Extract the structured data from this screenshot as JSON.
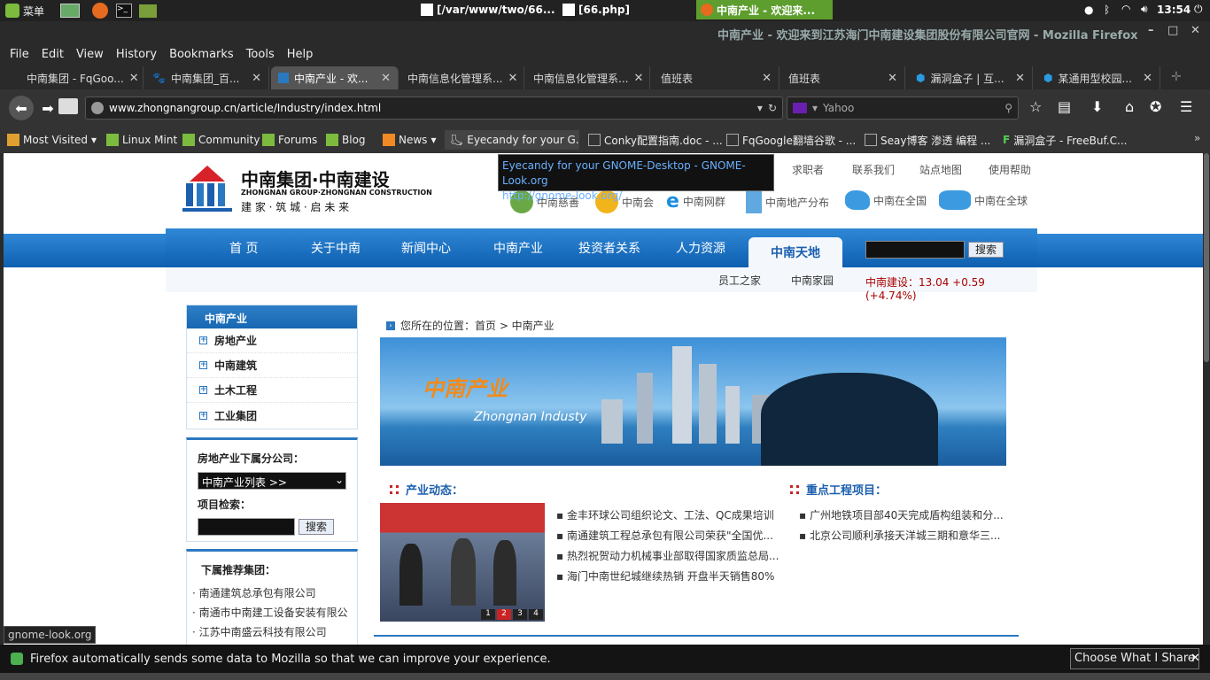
{
  "panel": {
    "menu": "菜单",
    "tasks": [
      "[/var/www/two/66...",
      "[66.php]",
      "中南产业 - 欢迎来..."
    ],
    "clock": "13:54"
  },
  "window_title": "中南产业 - 欢迎来到江苏海门中南建设集团股份有限公司官网 - Mozilla Firefox",
  "menu": [
    "File",
    "Edit",
    "View",
    "History",
    "Bookmarks",
    "Tools",
    "Help"
  ],
  "tabs": [
    "中南集团 - FqGoo...",
    "中南集团_百...",
    "中南产业 - 欢...",
    "中南信息化管理系...",
    "中南信息化管理系...",
    "值班表",
    "值班表",
    "漏洞盒子 | 互...",
    "某通用型校园..."
  ],
  "url": "www.zhongnangroup.cn/article/Industry/index.html",
  "search_engine": "Yahoo",
  "bookmarks": [
    "Most Visited",
    "Linux Mint",
    "Community",
    "Forums",
    "Blog",
    "News",
    "Eyecandy for your G...",
    "Conky配置指南.doc - ...",
    "FqGoogle翻墙谷歌 - ...",
    "Seay博客 渗透 编程 ...",
    "漏洞盒子 - FreeBuf.C..."
  ],
  "tooltip": {
    "title": "Eyecandy for your GNOME-Desktop - GNOME-Look.org",
    "url": "http://gnome-look.org/"
  },
  "site": {
    "logo_cn": "中南集团·中南建设",
    "logo_en": "ZHONGNAN GROUP·ZHONGNAN CONSTRUCTION",
    "logo_slogan": "建 家 · 筑 城 · 启 未 来",
    "top_links": [
      "求职者",
      "联系我们",
      "站点地图",
      "使用帮助"
    ],
    "quick_links": [
      "中南慈善",
      "中南会",
      "中南网群",
      "中南地产分布",
      "中南在全国",
      "中南在全球"
    ],
    "nav": [
      "首  页",
      "关于中南",
      "新闻中心",
      "中南产业",
      "投资者关系",
      "人力资源",
      "中南天地"
    ],
    "search_btn": "搜索",
    "subnav": [
      "员工之家",
      "中南家园"
    ],
    "stock": "中南建设：13.04 +0.59 (+4.74%)",
    "side_title": "中南产业",
    "side_items": [
      "房地产业",
      "中南建筑",
      "土木工程",
      "工业集团"
    ],
    "sub_co_label": "房地产业下属分公司：",
    "select_value": "中南产业列表 >>",
    "proj_search_label": "项目检索：",
    "proj_search_btn": "搜索",
    "rec_title": "下属推荐集团：",
    "rec_items": [
      "南通建筑总承包有限公司",
      "南通市中南建工设备安装有限公",
      "江苏中南盛云科技有限公司"
    ],
    "breadcrumb": "您所在的位置：首页 > 中南产业",
    "banner_cn": "中南产业",
    "banner_en": "Zhongnan Industy",
    "news_title": "产业动态：",
    "news": [
      "金丰环球公司组织论文、工法、QC成果培训",
      "南通建筑工程总承包有限公司荣获\"全国优...",
      "热烈祝贺动力机械事业部取得国家质监总局...",
      "海门中南世纪城继续热销 开盘半天销售80%"
    ],
    "projects_title": "重点工程项目：",
    "projects": [
      "广州地铁项目部40天完成盾构组装和分...",
      "北京公司顺利承接天洋城三期和意华三..."
    ],
    "pager": [
      "1",
      "2",
      "3",
      "4"
    ]
  },
  "status_link": "gnome-look.org",
  "notification": {
    "text": "Firefox automatically sends some data to Mozilla so that we can improve your experience.",
    "button": "Choose What I Share"
  }
}
